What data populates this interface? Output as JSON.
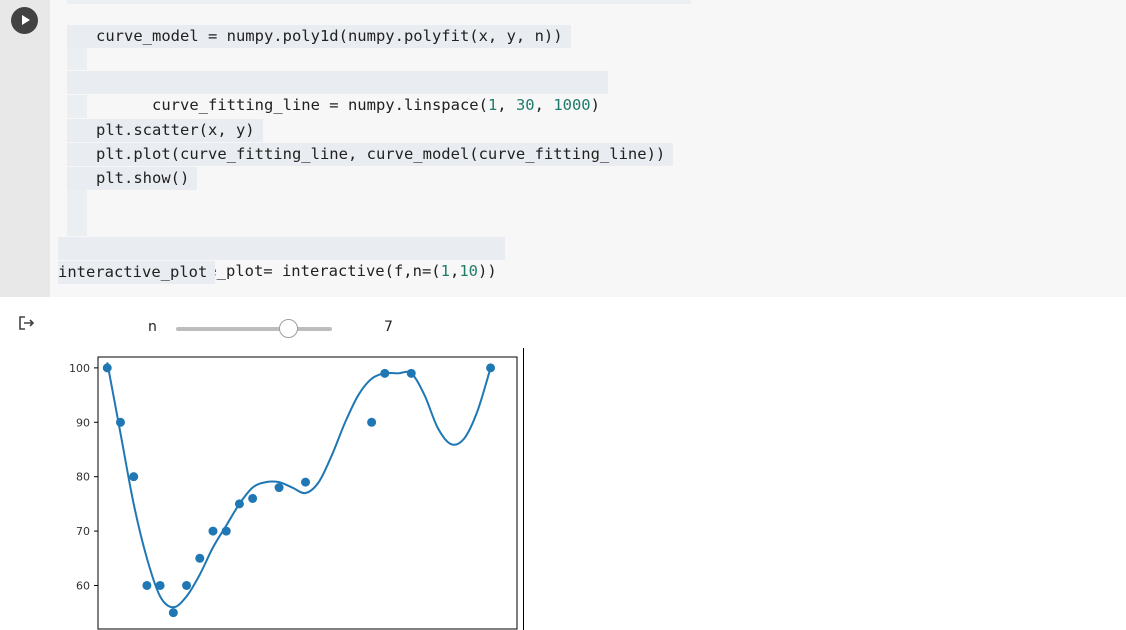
{
  "code_lines": {
    "l1": "curve_model = numpy.poly1d(numpy.polyfit(x, y, n))",
    "l2_prefix": "curve_fitting_line = numpy.linspace(",
    "l2_n1": "1",
    "l2_n2": "30",
    "l2_n3": "1000",
    "l2_suffix": ")",
    "l3": "plt.scatter(x, y)",
    "l4": "plt.plot(curve_fitting_line, curve_model(curve_fitting_line))",
    "l5": "plt.show()",
    "l6_prefix": "interactive_plot= interactive(f,n=(",
    "l6_n1": "1",
    "l6_n2": "10",
    "l6_suffix": "))",
    "l7": "interactive_plot"
  },
  "widget": {
    "label": "n",
    "value": "7",
    "min": 1,
    "max": 10,
    "current": 7
  },
  "icons": {
    "run": "play-circle-icon",
    "output": "output-redirect-icon"
  },
  "chart_data": {
    "type": "scatter",
    "x": [
      1,
      2,
      3,
      4,
      5,
      6,
      7,
      8,
      9,
      10,
      11,
      12,
      14,
      16,
      21,
      22,
      24,
      30
    ],
    "y": [
      100,
      90,
      80,
      60,
      60,
      55,
      60,
      65,
      70,
      70,
      75,
      76,
      78,
      79,
      90,
      99,
      99,
      100
    ],
    "fit_line": {
      "x": [
        1,
        2,
        3,
        4,
        5,
        6,
        7,
        8,
        9,
        10,
        11,
        12,
        13,
        14,
        15,
        16,
        17,
        18,
        19,
        20,
        21,
        22,
        23,
        24,
        25,
        26,
        27,
        28,
        29,
        30
      ],
      "y": [
        101,
        88,
        75,
        65,
        58,
        56,
        58,
        62,
        67,
        71,
        75,
        78,
        79,
        79,
        78,
        77,
        79,
        84,
        90,
        95,
        98,
        99,
        99,
        99,
        95,
        89,
        86,
        87,
        92,
        100
      ]
    },
    "yticks": [
      60,
      70,
      80,
      90,
      100
    ],
    "xlim": [
      0.3,
      32
    ],
    "ylim": [
      52,
      102
    ],
    "colors": {
      "points": "#1f77b4",
      "line": "#1f77b4"
    },
    "grid": false
  }
}
